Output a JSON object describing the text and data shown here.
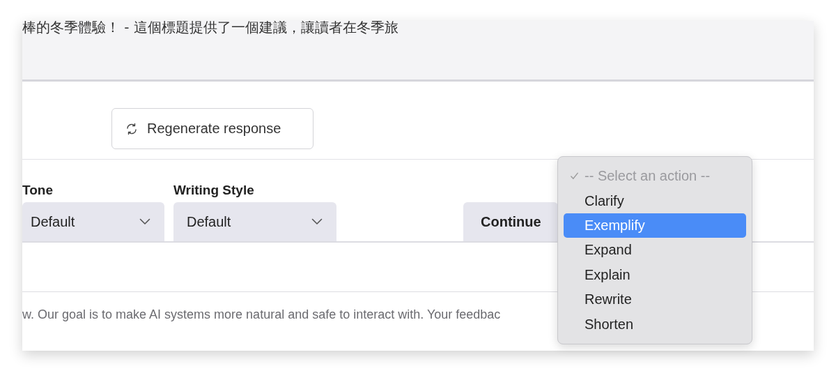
{
  "message_text": "棒的冬季體驗！ - 這個標題提供了一個建議，讓讀者在冬季旅",
  "regenerate_button": {
    "label": "Regenerate response"
  },
  "selects": [
    {
      "label": "Tone",
      "value": "Default"
    },
    {
      "label": "Writing Style",
      "value": "Default"
    }
  ],
  "continue_button": {
    "label": "Continue"
  },
  "action_menu": {
    "items": [
      {
        "label": "-- Select an action --",
        "checked": true,
        "disabled": true,
        "selected": false
      },
      {
        "label": "Clarify",
        "checked": false,
        "disabled": false,
        "selected": false
      },
      {
        "label": "Exemplify",
        "checked": false,
        "disabled": false,
        "selected": true
      },
      {
        "label": "Expand",
        "checked": false,
        "disabled": false,
        "selected": false
      },
      {
        "label": "Explain",
        "checked": false,
        "disabled": false,
        "selected": false
      },
      {
        "label": "Rewrite",
        "checked": false,
        "disabled": false,
        "selected": false
      },
      {
        "label": "Shorten",
        "checked": false,
        "disabled": false,
        "selected": false
      }
    ]
  },
  "footer_text": "w. Our goal is to make AI systems more natural and safe to interact with. Your feedbac"
}
